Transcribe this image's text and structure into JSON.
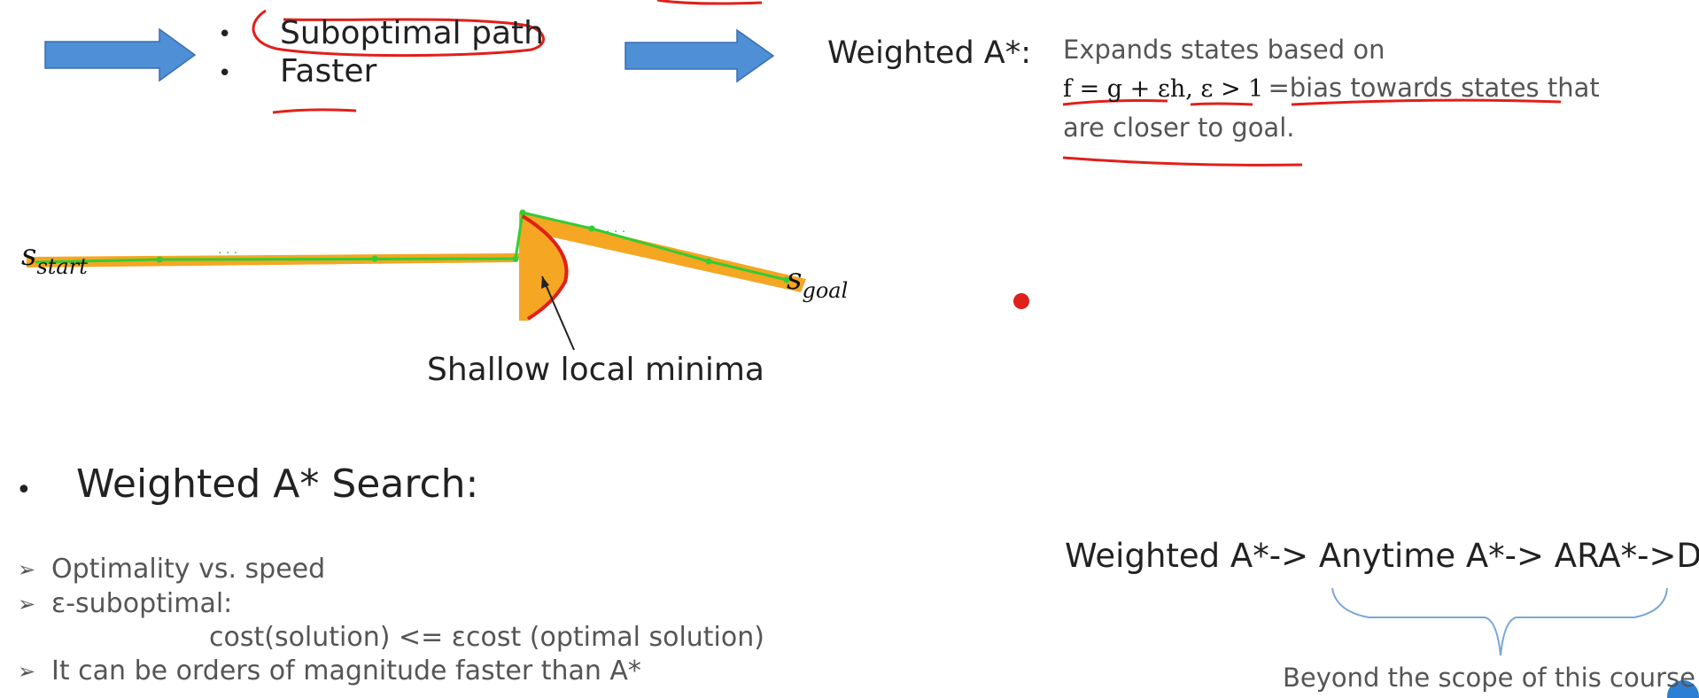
{
  "top_bullets": [
    "Suboptimal path",
    "Faster"
  ],
  "weighted_label": "Weighted A*:",
  "description": {
    "line1": "Expands states based on",
    "equation": "f = g + εh, ε > 1",
    "line2_rest": "=bias towards states that",
    "line3": "are closer to goal."
  },
  "diagram": {
    "start_s": "s",
    "start_sub": "start",
    "goal_s": "s",
    "goal_sub": "goal",
    "dots": "· · ·",
    "caption": "Shallow local minima"
  },
  "section": {
    "bullet": "•",
    "title": "Weighted A* Search:"
  },
  "points": [
    {
      "text": "Optimality vs. speed"
    },
    {
      "text": "ε-suboptimal:"
    },
    {
      "text": "cost(solution) <= εcost (optimal solution)"
    },
    {
      "text": "It can be orders of magnitude faster than A*"
    }
  ],
  "chain": "Weighted A*-> Anytime A*-> ARA*->D*",
  "scope_note": "Beyond the scope of this course",
  "colors": {
    "arrow_fill": "#4e8fd6",
    "arrow_stroke": "#3a6fb0",
    "orange": "#f5a623",
    "green": "#33cc33",
    "red": "#e0201a",
    "brace": "#7aa7d6",
    "badge": "#2a7fd4"
  },
  "icons": [
    "right-arrow-icon",
    "bullet-icon",
    "chevron-right-icon",
    "brace-icon"
  ]
}
